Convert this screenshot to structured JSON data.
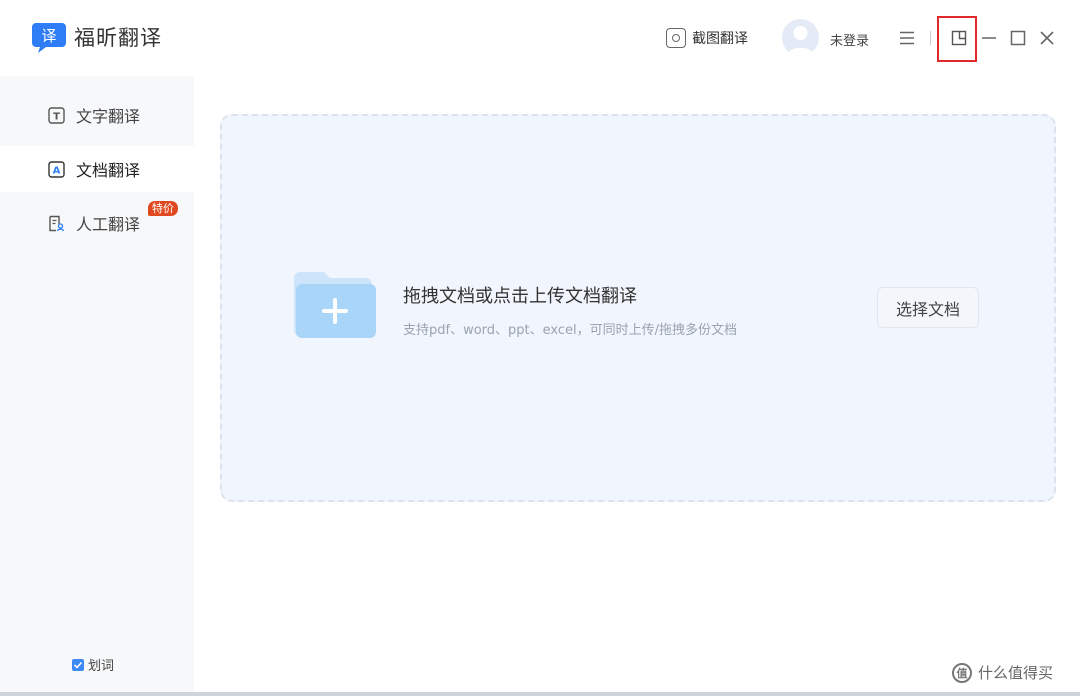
{
  "app": {
    "logo_glyph": "译",
    "title": "福昕翻译",
    "brand_color": "#2f7df6"
  },
  "header": {
    "screenshot_label": "截图翻译",
    "login_label": "未登录",
    "icons": [
      "camera-icon",
      "avatar-icon",
      "menu-icon",
      "mini-window-icon",
      "minimize-icon",
      "maximize-icon",
      "close-icon"
    ],
    "highlight_color": "#e0292a"
  },
  "sidebar": {
    "items": [
      {
        "label": "文字翻译",
        "icon": "text-translate-icon",
        "icon_glyph": "T"
      },
      {
        "label": "文档翻译",
        "icon": "document-translate-icon",
        "icon_glyph": "A"
      },
      {
        "label": "人工翻译",
        "icon": "human-translate-icon",
        "badge": "特价"
      }
    ],
    "active_index": 1,
    "huaci": {
      "label": "划词",
      "checked": true
    }
  },
  "dropzone": {
    "title": "拖拽文档或点击上传文档翻译",
    "subtitle": "支持pdf、word、ppt、excel，可同时上传/拖拽多份文档",
    "button_label": "选择文档"
  },
  "watermark": {
    "glyph": "值",
    "text": "什么值得买"
  }
}
